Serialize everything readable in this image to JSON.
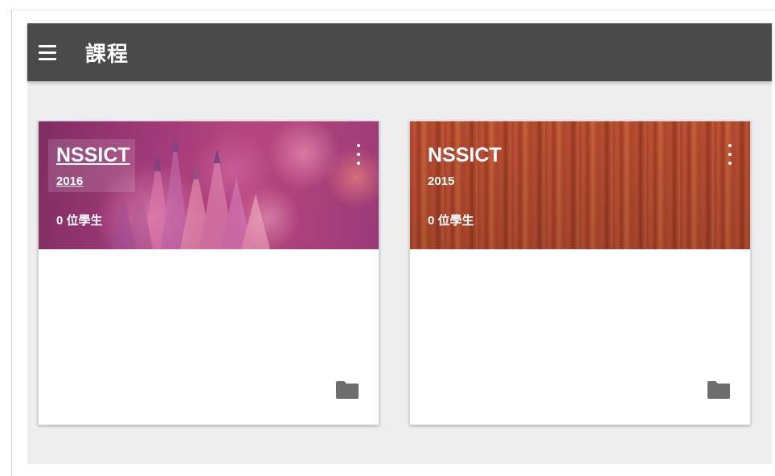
{
  "appbar": {
    "title": "課程",
    "menu_icon": "hamburger-menu-icon",
    "background": "#4a4a4a"
  },
  "courses": [
    {
      "title": "NSSICT",
      "section": "2016",
      "students": "0 位學生",
      "theme": "magenta-pencils",
      "folder_icon": "folder-icon",
      "more_icon": "more-vert-icon"
    },
    {
      "title": "NSSICT",
      "section": "2015",
      "students": "0 位學生",
      "theme": "orange-wood",
      "folder_icon": "folder-icon",
      "more_icon": "more-vert-icon"
    }
  ],
  "colors": {
    "page_background": "#eeeeee",
    "card_background": "#ffffff",
    "folder_icon": "#6d6d6d"
  }
}
